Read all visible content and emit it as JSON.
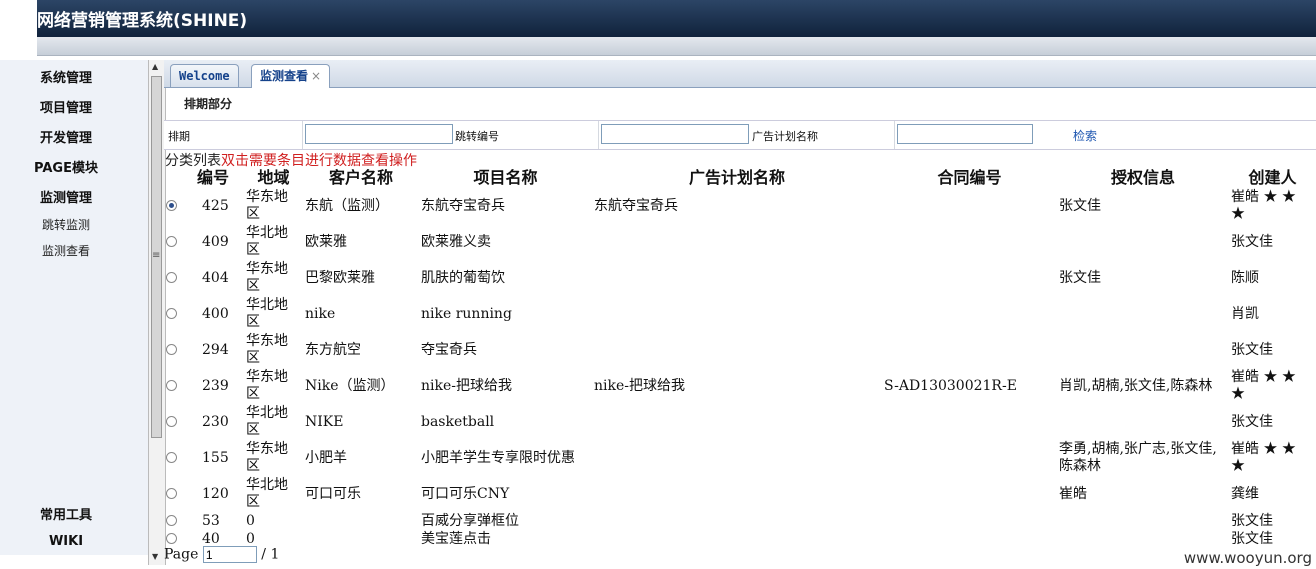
{
  "app": {
    "title": "网络营销管理系统(SHINE)"
  },
  "sidebar": {
    "items": [
      {
        "label": "系统管理"
      },
      {
        "label": "项目管理"
      },
      {
        "label": "开发管理"
      },
      {
        "label": "PAGE模块"
      },
      {
        "label": "监测管理"
      }
    ],
    "subitems": [
      {
        "label": "跳转监测"
      },
      {
        "label": "监测查看"
      }
    ],
    "bottom": [
      {
        "label": "常用工具"
      },
      {
        "label": "WIKI"
      }
    ]
  },
  "tabs": [
    {
      "label": "Welcome"
    },
    {
      "label": "监测查看",
      "close": "×"
    }
  ],
  "section_title": "排期部分",
  "filter": {
    "schedule_label": "排期",
    "jump_code_label": "跳转编号",
    "ad_plan_label": "广告计划名称",
    "search_label": "检索"
  },
  "list": {
    "caption": "分类列表",
    "hint": "双击需要条目进行数据查看操作"
  },
  "table": {
    "headers": [
      "编号",
      "地域",
      "客户名称",
      "项目名称",
      "广告计划名称",
      "合同编号",
      "授权信息",
      "创建人"
    ],
    "rows": [
      {
        "selected": true,
        "id": "425",
        "region": "华东地区",
        "client": "东航（监测）",
        "project": "东航夺宝奇兵",
        "ad_plan": "东航夺宝奇兵",
        "contract": "",
        "auth": "张文佳",
        "creator": "崔皓 ★ ★ ★"
      },
      {
        "selected": false,
        "id": "409",
        "region": "华北地区",
        "client": "欧莱雅",
        "project": "欧莱雅义卖",
        "ad_plan": "",
        "contract": "",
        "auth": "",
        "creator": "张文佳"
      },
      {
        "selected": false,
        "id": "404",
        "region": "华东地区",
        "client": "巴黎欧莱雅",
        "project": "肌肤的葡萄饮",
        "ad_plan": "",
        "contract": "",
        "auth": "张文佳",
        "creator": "陈顺"
      },
      {
        "selected": false,
        "id": "400",
        "region": "华北地区",
        "client": "nike",
        "project": "nike running",
        "ad_plan": "",
        "contract": "",
        "auth": "",
        "creator": "肖凯"
      },
      {
        "selected": false,
        "id": "294",
        "region": "华东地区",
        "client": "东方航空",
        "project": "夺宝奇兵",
        "ad_plan": "",
        "contract": "",
        "auth": "",
        "creator": "张文佳"
      },
      {
        "selected": false,
        "id": "239",
        "region": "华东地区",
        "client": "Nike（监测）",
        "project": "nike-把球给我",
        "ad_plan": "nike-把球给我",
        "contract": "S-AD13030021R-E",
        "auth": "肖凯,胡楠,张文佳,陈森林",
        "creator": "崔皓 ★ ★ ★"
      },
      {
        "selected": false,
        "id": "230",
        "region": "华北地区",
        "client": "NIKE",
        "project": "basketball",
        "ad_plan": "",
        "contract": "",
        "auth": "",
        "creator": "张文佳"
      },
      {
        "selected": false,
        "id": "155",
        "region": "华东地区",
        "client": "小肥羊",
        "project": "小肥羊学生专享限时优惠",
        "ad_plan": "",
        "contract": "",
        "auth": "李勇,胡楠,张广志,张文佳,陈森林",
        "creator": "崔皓 ★ ★ ★"
      },
      {
        "selected": false,
        "id": "120",
        "region": "华北地区",
        "client": "可口可乐",
        "project": "可口可乐CNY",
        "ad_plan": "",
        "contract": "",
        "auth": "崔皓",
        "creator": "龚维"
      },
      {
        "selected": false,
        "id": "53",
        "region": "0",
        "client": "",
        "project": "百威分享弹框位",
        "ad_plan": "",
        "contract": "",
        "auth": "",
        "creator": "张文佳"
      },
      {
        "selected": false,
        "id": "40",
        "region": "0",
        "client": "",
        "project": "美宝莲点击",
        "ad_plan": "",
        "contract": "",
        "auth": "",
        "creator": "张文佳"
      }
    ]
  },
  "pager": {
    "label": "Page",
    "value": "1",
    "total": "/ 1"
  },
  "watermark": "www.wooyun.org"
}
